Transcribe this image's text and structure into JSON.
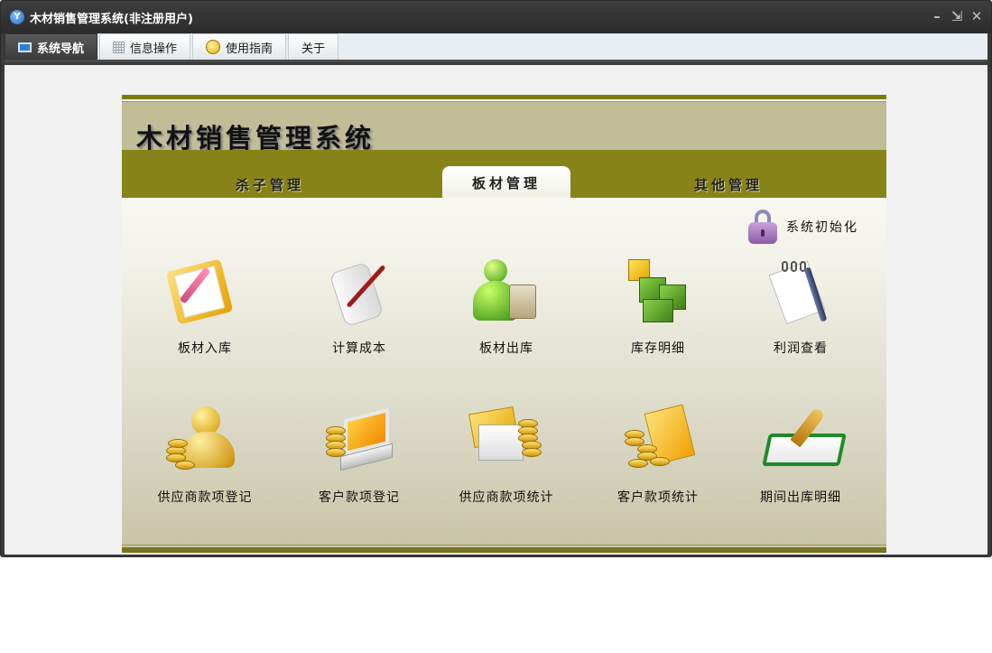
{
  "window": {
    "title": "木材销售管理系统(非注册用户)",
    "app_icon_letter": "Y",
    "controls": {
      "minimize": "–",
      "restore": "⇲",
      "close": "✕"
    }
  },
  "menubar": {
    "tabs": [
      {
        "label": "系统导航",
        "icon": "monitor-icon",
        "active": true
      },
      {
        "label": "信息操作",
        "icon": "grid-icon",
        "active": false
      },
      {
        "label": "使用指南",
        "icon": "guide-icon",
        "active": false
      },
      {
        "label": "关于",
        "icon": "",
        "active": false
      }
    ]
  },
  "panel": {
    "system_title": "木材销售管理系统",
    "category_tabs": [
      {
        "label": "杀子管理",
        "active": false
      },
      {
        "label": "板材管理",
        "active": true
      },
      {
        "label": "其他管理",
        "active": false
      }
    ],
    "init_button": {
      "label": "系统初始化",
      "icon": "lock-icon"
    },
    "items_row1": [
      {
        "label": "板材入库",
        "icon": "clipboard-icon"
      },
      {
        "label": "计算成本",
        "icon": "scroll-quill-icon"
      },
      {
        "label": "板材出库",
        "icon": "user-shopping-bag-icon"
      },
      {
        "label": "库存明细",
        "icon": "stacked-blocks-icon"
      },
      {
        "label": "利润查看",
        "icon": "notepad-pen-icon"
      }
    ],
    "items_row2": [
      {
        "label": "供应商款项登记",
        "icon": "gold-user-coins-icon"
      },
      {
        "label": "客户款项登记",
        "icon": "laptop-coins-icon"
      },
      {
        "label": "供应商款项统计",
        "icon": "documents-coins-icon"
      },
      {
        "label": "客户款项统计",
        "icon": "coins-card-icon"
      },
      {
        "label": "期间出库明细",
        "icon": "book-quill-icon"
      }
    ]
  }
}
